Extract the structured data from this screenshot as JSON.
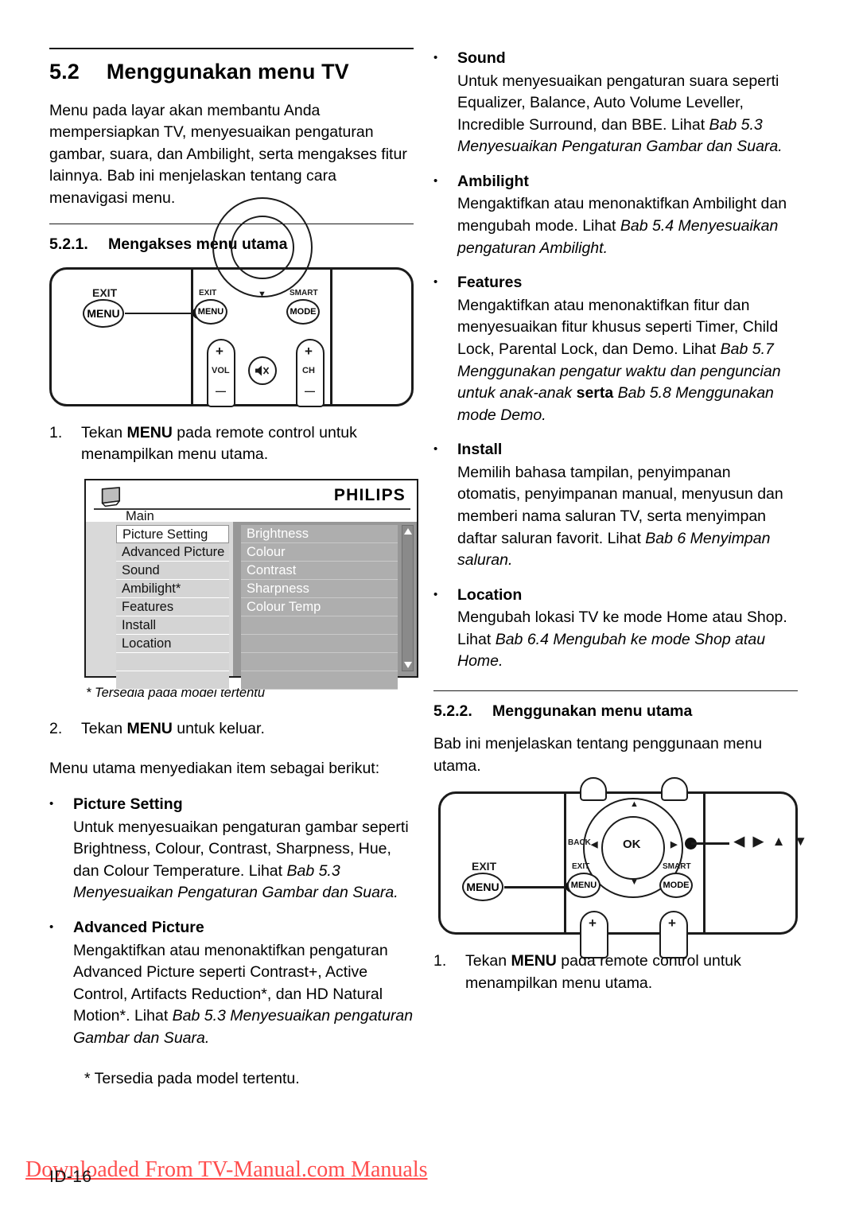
{
  "section": {
    "number": "5.2",
    "title": "Menggunakan menu TV",
    "intro": "Menu pada layar akan membantu Anda mempersiapkan TV, menyesuaikan pengaturan gambar, suara, dan Ambilight, serta mengakses fitur lainnya. Bab ini menjelaskan tentang cara menavigasi menu."
  },
  "subsection_521": {
    "number": "5.2.1.",
    "title": "Mengakses menu utama",
    "step1_num": "1.",
    "step1_pre": "Tekan ",
    "step1_key": "MENU",
    "step1_post": " pada remote control untuk menampilkan menu utama.",
    "caption": "* Tersedia pada model tertentu",
    "step2_num": "2.",
    "step2_pre": "Tekan ",
    "step2_key": "MENU",
    "step2_post": " untuk keluar.",
    "lead_in": "Menu utama menyediakan item sebagai berikut:"
  },
  "subsection_522": {
    "number": "5.2.2.",
    "title": "Menggunakan menu utama",
    "intro": "Bab ini menjelaskan tentang penggunaan menu utama.",
    "step1_num": "1.",
    "step1_pre": "Tekan ",
    "step1_key": "MENU",
    "step1_post": " pada remote control untuk menampilkan menu utama."
  },
  "menu_items": [
    {
      "heading": "Picture Setting",
      "body_1": "Untuk menyesuaikan pengaturan gambar seperti Brightness, Colour, Contrast, Sharpness, Hue, dan Colour Temperature. Lihat ",
      "italic_1": "Bab 5.3 Menyesuaikan Pengaturan Gambar dan Suara.",
      "body_2": "",
      "italic_2": "",
      "body_3": ""
    },
    {
      "heading": "Advanced Picture",
      "body_1": "Mengaktifkan atau menonaktifkan pengaturan Advanced Picture seperti Contrast+, Active Control, Artifacts Reduction*, dan HD Natural Motion*. Lihat ",
      "italic_1": "Bab 5.3 Menyesuaikan pengaturan Gambar dan Suara.",
      "body_2": "",
      "italic_2": "",
      "body_3": ""
    },
    {
      "heading": "Sound",
      "body_1": "Untuk menyesuaikan pengaturan suara seperti Equalizer, Balance, Auto Volume Leveller, Incredible Surround, dan BBE. Lihat ",
      "italic_1": "Bab 5.3 Menyesuaikan Pengaturan Gambar dan Suara.",
      "body_2": "",
      "italic_2": "",
      "body_3": ""
    },
    {
      "heading": "Ambilight",
      "body_1": "Mengaktifkan atau menonaktifkan Ambilight dan mengubah mode. Lihat ",
      "italic_1": "Bab 5.4 Menyesuaikan pengaturan Ambilight.",
      "body_2": "",
      "italic_2": "",
      "body_3": ""
    },
    {
      "heading": "Features",
      "body_1": "Mengaktifkan atau menonaktifkan fitur dan menyesuaikan fitur khusus seperti Timer, Child Lock, Parental Lock, dan Demo. Lihat ",
      "italic_1": "Bab 5.7 Menggunakan pengatur waktu dan penguncian untuk anak-anak ",
      "body_2": "serta",
      "italic_2": " Bab 5.8 Menggunakan mode Demo.",
      "body_3": ""
    },
    {
      "heading": "Install",
      "body_1": "Memilih bahasa tampilan, penyimpanan otomatis, penyimpanan manual, menyusun dan memberi nama saluran TV, serta menyimpan daftar saluran favorit. Lihat ",
      "italic_1": "Bab 6 Menyimpan saluran.",
      "body_2": "",
      "italic_2": "",
      "body_3": ""
    },
    {
      "heading": "Location",
      "body_1": "Mengubah lokasi TV ke mode Home atau Shop. Lihat ",
      "italic_1": "Bab 6.4 Mengubah ke mode Shop atau Home.",
      "body_2": "",
      "italic_2": "",
      "body_3": ""
    }
  ],
  "footnote": "* Tersedia pada model tertentu.",
  "osd": {
    "brand": "PHILIPS",
    "title": "Main",
    "left_items": [
      "Picture Setting",
      "Advanced Picture",
      "Sound",
      "Ambilight*",
      "Features",
      "Install",
      "Location"
    ],
    "selected_index": 0,
    "right_items": [
      "Brightness",
      "Colour",
      "Contrast",
      "Sharpness",
      "Colour Temp"
    ],
    "colors": {
      "left_panel_bg": "#d9d9d9",
      "left_item_bg": "#d4d4d4",
      "selected_bg": "#ffffff",
      "right_panel_bg": "#979797",
      "right_item_bg": "#aeaeae",
      "right_item_text": "#ffffff",
      "scrollbar_bg": "#8a8a8a"
    }
  },
  "remote_top": {
    "callout_label": "EXIT",
    "callout_button": "MENU",
    "btn_exit_small": "EXIT",
    "btn_menu_small": "MENU",
    "btn_smart_small": "SMART",
    "btn_mode": "MODE",
    "vol_label": "VOL",
    "ch_label": "CH",
    "plus": "+",
    "minus": "—",
    "mute_icon": "mute-icon",
    "down_arrow": "▼"
  },
  "remote_bottom": {
    "callout_label": "EXIT",
    "callout_button": "MENU",
    "btn_exit_small": "EXIT",
    "btn_menu_small": "MENU",
    "btn_smart_small": "SMART",
    "btn_mode": "MODE",
    "back_label": "BACK",
    "ok_label": "OK",
    "up_arrow": "▲",
    "down_arrow": "▼",
    "left_arrow": "◀",
    "right_arrow": "▶",
    "callout_arrows": "◀ ▶ ▲ ▼",
    "plus": "+"
  },
  "footer": {
    "page_number": "ID-16",
    "watermark": "Downloaded From TV-Manual.com Manuals",
    "watermark_color": "#ff4d4d"
  }
}
